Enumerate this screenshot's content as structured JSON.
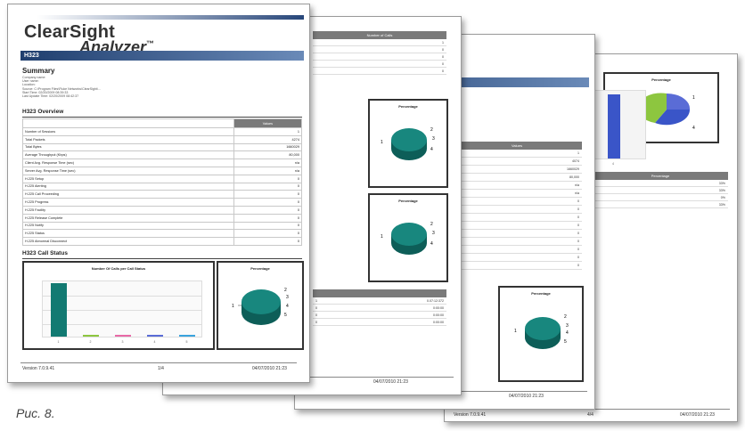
{
  "app": {
    "logo_line1": "ClearSight",
    "logo_line2": "Analyzer",
    "logo_tm": "™"
  },
  "report": {
    "title_bar": "H323",
    "summary_heading": "Summary",
    "summary_lines": [
      "Company name:",
      "User name:",
      "Location:",
      "Source: C:\\Program Files\\Fluke Networks\\ClearSight\\...",
      "Start Time: 02/20/2009 08:39:33",
      "Last Update Time: 02/20/2009 08:42:37"
    ],
    "overview_heading": "H323 Overview",
    "overview_header_values": "Values",
    "overview_rows": [
      {
        "label": "Number of Sessions",
        "value": "1"
      },
      {
        "label": "Total Packets",
        "value": "4274"
      },
      {
        "label": "Total Bytes",
        "value": "1660029"
      },
      {
        "label": "Average Throughput (Kbps)",
        "value": "80,000"
      },
      {
        "label": "Client Avg. Response Time (sec)",
        "value": "n/a"
      },
      {
        "label": "Server Avg. Response Time (sec)",
        "value": "n/a"
      },
      {
        "label": "H.225 Setup",
        "value": "0"
      },
      {
        "label": "H.225 Alerting",
        "value": "0"
      },
      {
        "label": "H.225 Call Proceeding",
        "value": "0"
      },
      {
        "label": "H.225 Progress",
        "value": "0"
      },
      {
        "label": "H.225 Facility",
        "value": "0"
      },
      {
        "label": "H.225 Release Complete",
        "value": "0"
      },
      {
        "label": "H.225 Notify",
        "value": "0"
      },
      {
        "label": "H.225 Status",
        "value": "0"
      },
      {
        "label": "H.225 Abnormal Disconnect",
        "value": "0"
      }
    ],
    "call_status_heading": "H323 Call Status",
    "chart_title": "Number Of Calls per Call Status",
    "pie_title": "Percentage",
    "pie_labels": [
      "1",
      "2",
      "3",
      "4",
      "5"
    ],
    "footer_version": "Version 7.0.9.41",
    "footer_page": "1/4",
    "footer_date": "04/07/2010 21:23"
  },
  "page2": {
    "header": "Number of Calls",
    "rows": [
      "1",
      "0",
      "0",
      "0",
      "0"
    ],
    "pie_title": "Percentage",
    "pie_labels": [
      "1",
      "2",
      "3",
      "4"
    ],
    "pie_title_2": "Percentage",
    "pie_labels_2": [
      "1",
      "2",
      "3",
      "4"
    ],
    "table_rows": [
      [
        "1",
        "0.07:12:372"
      ],
      [
        "0",
        "0:00:00"
      ],
      [
        "0",
        "0:00:00"
      ],
      [
        "0",
        "0:00:00"
      ]
    ],
    "footer_date": "04/07/2010 21:23"
  },
  "page3": {
    "header_values": "Values",
    "values": [
      "1",
      "4074",
      "1660029",
      "80,000",
      "n/a",
      "n/a",
      "0",
      "0",
      "0",
      "0",
      "0",
      "0",
      "0",
      "0",
      "0"
    ],
    "pie_title": "Percentage",
    "pie_labels": [
      "1",
      "2",
      "3",
      "4",
      "5"
    ],
    "footer_date": "04/07/2010 21:23"
  },
  "page4": {
    "pie_title": "Percentage",
    "pie_labels": [
      "1",
      "2",
      "4"
    ],
    "bar_label": "4",
    "header_percentage": "Percentage",
    "percent_rows": [
      "33%",
      "33%",
      "0%",
      "33%"
    ],
    "footer_version": "Version 7.0.9.41",
    "footer_page": "4/4",
    "footer_date": "04/07/2010 21:23"
  },
  "chart_data": {
    "type": "bar",
    "title": "Number Of Calls per Call Status",
    "categories": [
      "1",
      "2",
      "3",
      "4",
      "5"
    ],
    "values": [
      1,
      0,
      0,
      0,
      0
    ],
    "bar_colors": [
      "#127a72",
      "#8dc63f",
      "#e86aa7",
      "#5a6cd6",
      "#3aa3dd"
    ],
    "ylim": [
      0,
      1
    ]
  },
  "caption": "Рис. 8."
}
